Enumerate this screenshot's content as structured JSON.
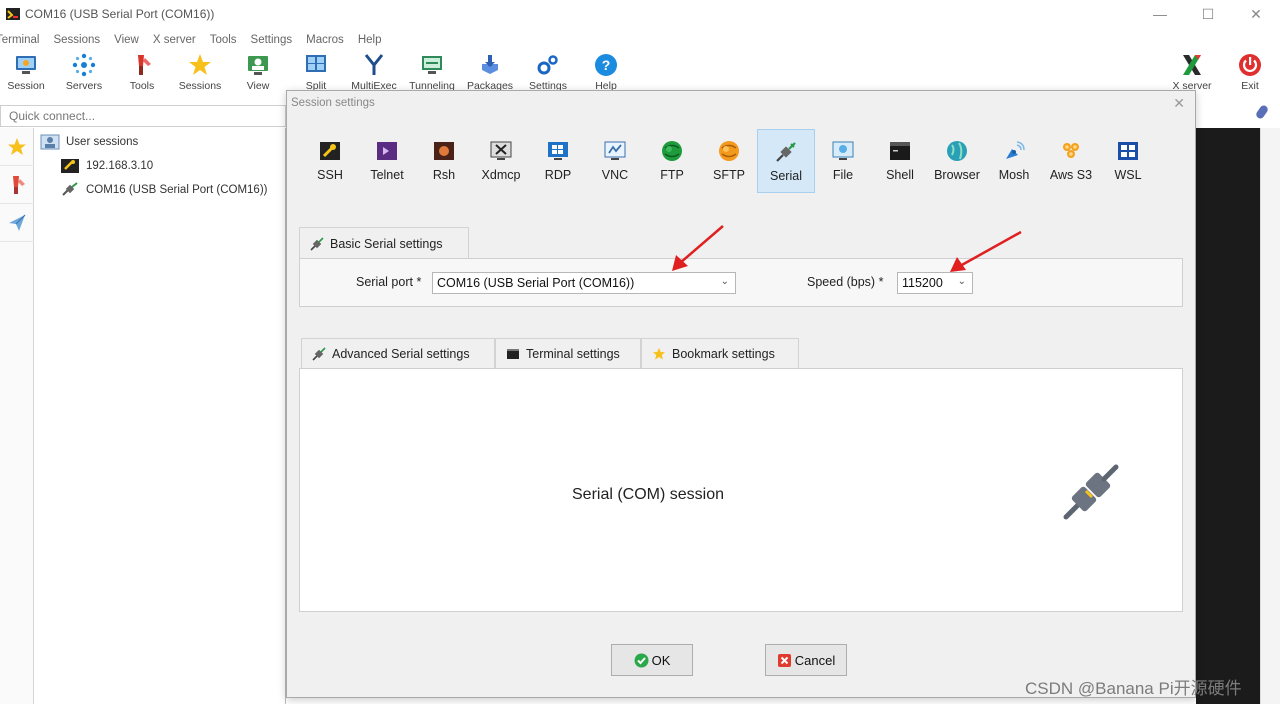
{
  "window": {
    "title": "COM16  (USB Serial Port (COM16))",
    "controls": {
      "minimize": "—",
      "maximize": "☐",
      "close": "✕"
    }
  },
  "menu": [
    "Terminal",
    "Sessions",
    "View",
    "X server",
    "Tools",
    "Settings",
    "Macros",
    "Help"
  ],
  "toolbar": {
    "items": [
      {
        "label": "Session",
        "icon": "session-icon"
      },
      {
        "label": "Servers",
        "icon": "servers-icon"
      },
      {
        "label": "Tools",
        "icon": "tools-icon"
      },
      {
        "label": "Sessions",
        "icon": "sessions-star-icon"
      },
      {
        "label": "View",
        "icon": "view-icon"
      },
      {
        "label": "Split",
        "icon": "split-icon"
      },
      {
        "label": "MultiExec",
        "icon": "multiexec-icon"
      },
      {
        "label": "Tunneling",
        "icon": "tunneling-icon"
      },
      {
        "label": "Packages",
        "icon": "packages-icon"
      },
      {
        "label": "Settings",
        "icon": "settings-icon"
      },
      {
        "label": "Help",
        "icon": "help-icon"
      }
    ],
    "xserver_label": "X server",
    "exit_label": "Exit"
  },
  "quick_connect": {
    "placeholder": "Quick connect..."
  },
  "tree": {
    "root": "User sessions",
    "items": [
      "192.168.3.10",
      "COM16  (USB Serial Port (COM16))"
    ]
  },
  "dialog": {
    "title": "Session settings",
    "types": [
      "SSH",
      "Telnet",
      "Rsh",
      "Xdmcp",
      "RDP",
      "VNC",
      "FTP",
      "SFTP",
      "Serial",
      "File",
      "Shell",
      "Browser",
      "Mosh",
      "Aws S3",
      "WSL"
    ],
    "active_type": "Serial",
    "basic_tab": "Basic Serial settings",
    "serial_port_label": "Serial port *",
    "serial_port_value": "COM16  (USB Serial Port (COM16))",
    "speed_label": "Speed (bps) *",
    "speed_value": "115200",
    "tabs": [
      "Advanced Serial settings",
      "Terminal settings",
      "Bookmark settings"
    ],
    "session_text": "Serial (COM) session",
    "ok_label": "OK",
    "cancel_label": "Cancel"
  },
  "watermark": "CSDN @Banana Pi开源硬件",
  "colors": {
    "active_type_bg": "#d5e8f7",
    "annotation_arrow": "#e02020",
    "terminal_bg": "#1b1b1b"
  }
}
